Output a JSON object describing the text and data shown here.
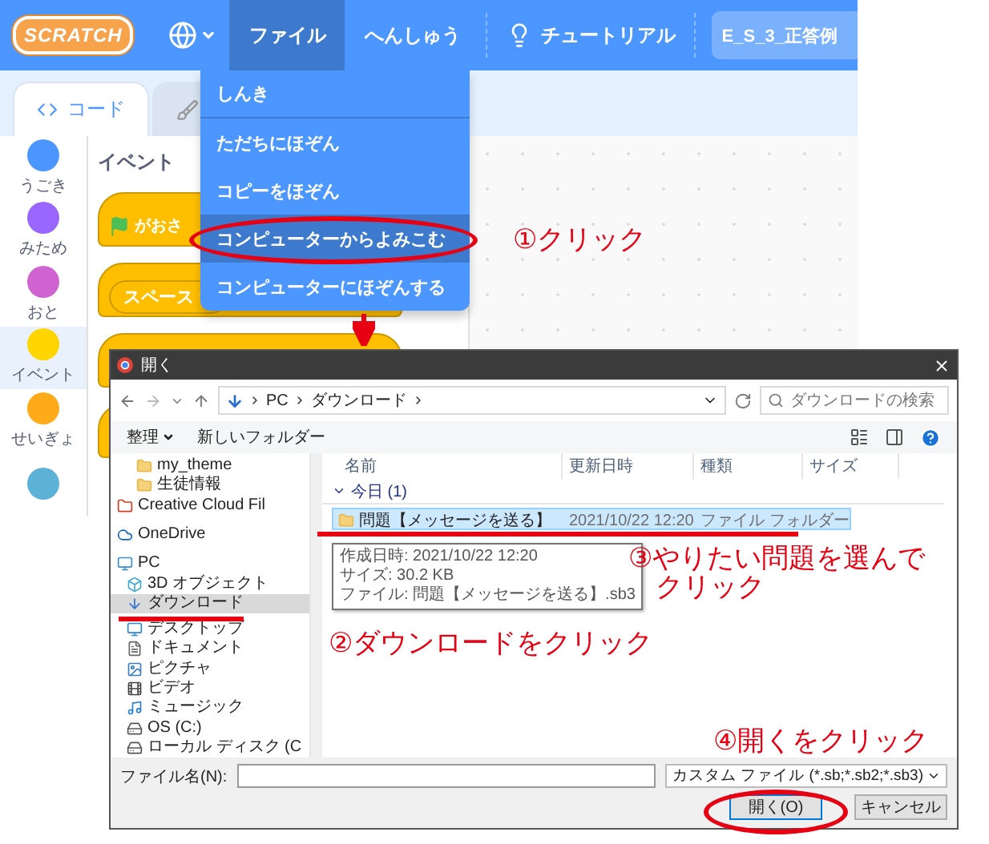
{
  "menu_bar": {
    "logo": "SCRATCH",
    "menus": [
      {
        "label": "ファイル",
        "selected": true
      },
      {
        "label": "へんしゅう",
        "selected": false
      }
    ],
    "tutorial": "チュートリアル",
    "project_title": "E_S_3_正答例"
  },
  "tabs": [
    {
      "kind": "code",
      "label": "コード",
      "selected": true
    },
    {
      "kind": "costume",
      "selected": false
    }
  ],
  "categories": [
    {
      "label": "うごき",
      "color": "#4c97ff",
      "selected": false
    },
    {
      "label": "みため",
      "color": "#9966ff",
      "selected": false
    },
    {
      "label": "おと",
      "color": "#cf63cf",
      "selected": false
    },
    {
      "label": "イベント",
      "color": "#ffd500",
      "selected": true
    },
    {
      "label": "せいぎょ",
      "color": "#ffab19",
      "selected": false
    },
    {
      "color": "#5cb1d6",
      "selected": false
    }
  ],
  "palette": {
    "heading": "イベント",
    "blocks": [
      {
        "kind": "flag_hat",
        "text": "がおさ"
      },
      {
        "kind": "key_hat",
        "dropdown": "スペース"
      },
      {
        "kind": "hat"
      },
      {
        "kind": "hat"
      }
    ]
  },
  "file_menu": {
    "items": [
      {
        "label": "しんき",
        "selected": false
      },
      {
        "label": "ただちにほぞん",
        "selected": false
      },
      {
        "label": "コピーをほぞん",
        "selected": false
      },
      {
        "label": "コンピューターからよみこむ",
        "selected": true
      },
      {
        "label": "コンピューターにほぞんする",
        "selected": false
      }
    ]
  },
  "dialog": {
    "title": "開く",
    "path": [
      "PC",
      "ダウンロード"
    ],
    "search_placeholder": "ダウンロードの検索",
    "organize": "整理",
    "new_folder": "新しいフォルダー",
    "nav": [
      {
        "kind": "folder",
        "label": "my_theme",
        "selected": false
      },
      {
        "kind": "folder",
        "label": "生徒情報",
        "selected": false
      },
      {
        "kind": "cloud_folder",
        "label": "Creative Cloud Fil",
        "selected": false
      },
      {
        "kind": "onedrive",
        "label": "OneDrive",
        "selected": false
      },
      {
        "kind": "pc",
        "label": "PC",
        "selected": false,
        "children": [
          {
            "kind": "objects3d",
            "label": "3D オブジェクト",
            "selected": false
          },
          {
            "kind": "download",
            "label": "ダウンロード",
            "selected": true
          },
          {
            "kind": "desktop",
            "label": "デスクトップ",
            "selected": false
          },
          {
            "kind": "documents",
            "label": "ドキュメント",
            "selected": false
          },
          {
            "kind": "pictures",
            "label": "ピクチャ",
            "selected": false
          },
          {
            "kind": "videos",
            "label": "ビデオ",
            "selected": false
          },
          {
            "kind": "music",
            "label": "ミュージック",
            "selected": false
          },
          {
            "kind": "drive",
            "label": "OS (C:)",
            "selected": false
          },
          {
            "kind": "drive",
            "label": "ローカル ディスク (C",
            "selected": false
          }
        ]
      }
    ],
    "columns": [
      "名前",
      "更新日時",
      "種類",
      "サイズ"
    ],
    "group": "今日 (1)",
    "rows": [
      {
        "name": "問題【メッセージを送る】",
        "modified": "2021/10/22 12:20",
        "type": "ファイル フォルダー",
        "selected": true
      }
    ],
    "tooltip": [
      "作成日時: 2021/10/22 12:20",
      "サイズ: 30.2 KB",
      "ファイル: 問題【メッセージを送る】.sb3"
    ],
    "filename_label": "ファイル名(N):",
    "filter": "カスタム ファイル (*.sb;*.sb2;*.sb3)",
    "buttons": [
      "開く(O)",
      "キャンセル"
    ]
  },
  "annotations": {
    "step1": "①クリック",
    "step2": "②ダウンロードをクリック",
    "step3": "③やりたい問題を選んでクリック",
    "step4": "④開くをクリック"
  }
}
